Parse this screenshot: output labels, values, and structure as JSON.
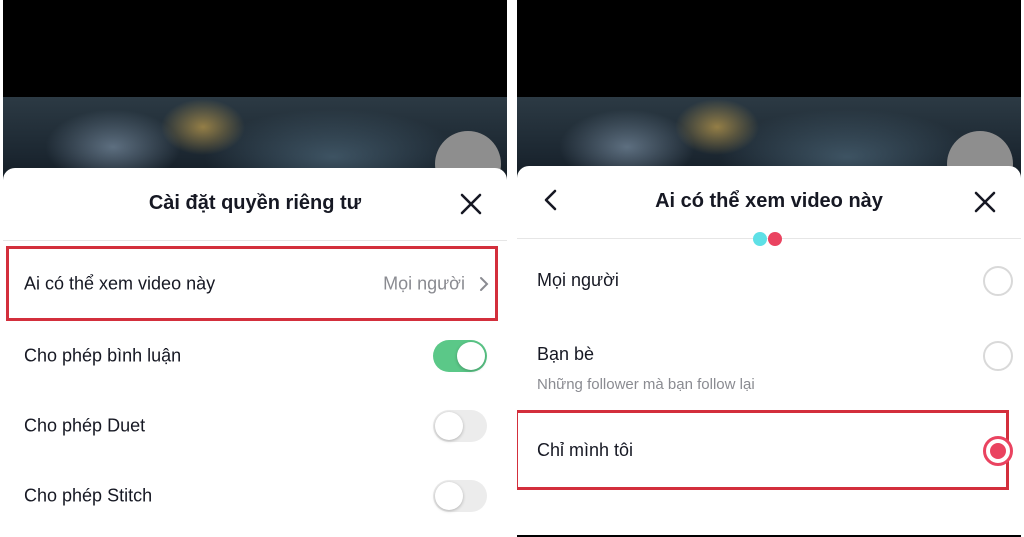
{
  "left": {
    "title": "Cài đặt quyền riêng tư",
    "rows": [
      {
        "label": "Ai có thể xem video này",
        "value": "Mọi người"
      },
      {
        "label": "Cho phép bình luận",
        "toggle": true
      },
      {
        "label": "Cho phép Duet",
        "toggle": false
      },
      {
        "label": "Cho phép Stitch",
        "toggle": false
      }
    ]
  },
  "right": {
    "title": "Ai có thể xem video này",
    "options": [
      {
        "label": "Mọi người",
        "selected": false
      },
      {
        "label": "Bạn bè",
        "sublabel": "Những follower mà bạn follow lại",
        "selected": false
      },
      {
        "label": "Chỉ mình tôi",
        "selected": true
      }
    ]
  },
  "colors": {
    "highlight": "#d32f3c",
    "toggle_on": "#5bc888",
    "radio_selected": "#ea4360",
    "dot_cyan": "#5ee0e6",
    "dot_red": "#ea4360"
  },
  "icons": [
    "close-icon",
    "back-icon",
    "chevron-right-icon"
  ]
}
